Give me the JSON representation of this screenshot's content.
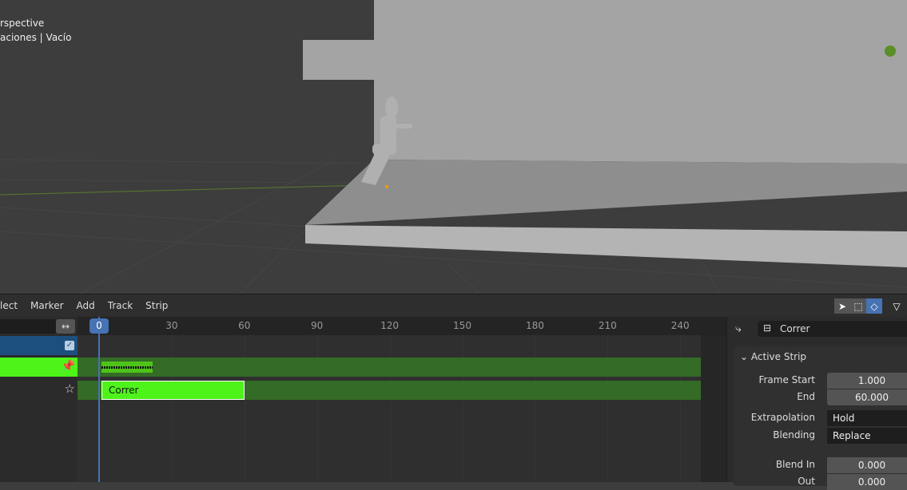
{
  "viewport": {
    "mode_label": "rspective",
    "collection_label": "aciones | Vacío"
  },
  "menu": [
    "lect",
    "Marker",
    "Add",
    "Track",
    "Strip"
  ],
  "toolbar": {
    "select_icon": "cursor-icon",
    "box_icon": "box-select-icon",
    "tweak_icon": "tweak-icon",
    "filter_icon": "filter-icon"
  },
  "channels": {
    "swap_icon": "↔"
  },
  "timeline": {
    "current_frame": "0",
    "ticks": [
      "30",
      "60",
      "90",
      "120",
      "150",
      "180",
      "210",
      "240"
    ],
    "strip_name": "Correr",
    "strip_start": 1,
    "strip_end": 60,
    "action_keys_end": 22
  },
  "properties": {
    "action_name": "Correr",
    "panel_title": "Active Strip",
    "fields": [
      {
        "label": "Frame Start",
        "value": "1.000"
      },
      {
        "label": "End",
        "value": "60.000"
      },
      {
        "label": "Extrapolation",
        "value": "Hold"
      },
      {
        "label": "Blending",
        "value": "Replace"
      },
      {
        "label": "Blend In",
        "value": "0.000"
      },
      {
        "label": "Out",
        "value": "0.000"
      }
    ]
  },
  "colors": {
    "accent": "#4772b3",
    "strip": "#4ef31a",
    "track": "#346b26"
  }
}
